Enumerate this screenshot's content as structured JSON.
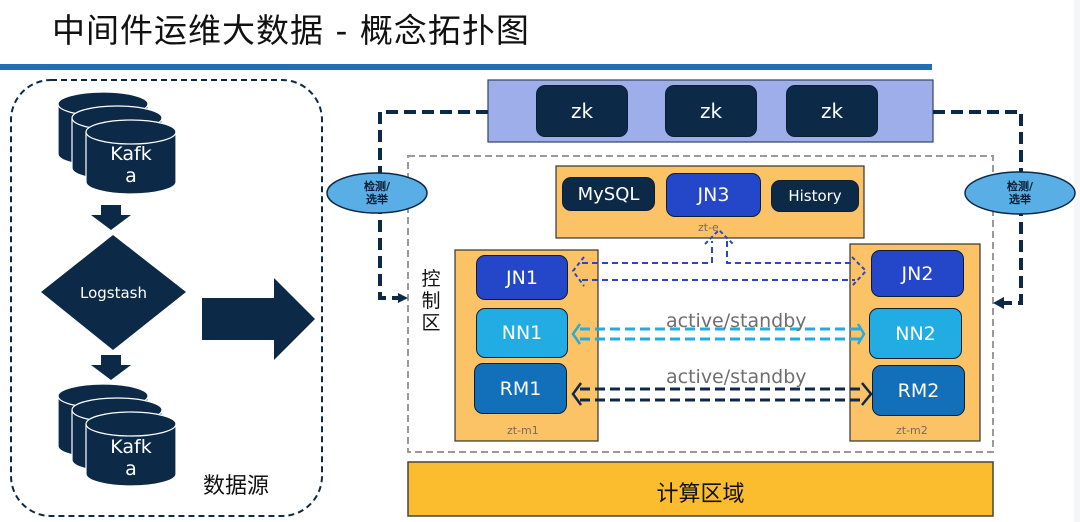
{
  "page": {
    "title": "中间件运维大数据 - 概念拓扑图",
    "accent_color": "#1f6fb6"
  },
  "data_source": {
    "label": "数据源",
    "top_store": {
      "label_line1": "Kafk",
      "label_line2": "a",
      "icon": "database-stack-icon"
    },
    "processor": {
      "label": "Logstash",
      "icon": "diamond-shape"
    },
    "bottom_store": {
      "label_line1": "Kafk",
      "label_line2": "a",
      "icon": "database-stack-icon"
    },
    "flow_arrow": "right-arrow-icon"
  },
  "zookeeper": {
    "nodes": [
      {
        "label": "zk"
      },
      {
        "label": "zk"
      },
      {
        "label": "zk"
      }
    ],
    "color": "#9eaeea"
  },
  "election": {
    "left_label_line1": "检测/",
    "left_label_line2": "选举",
    "right_label_line1": "检测/",
    "right_label_line2": "选举",
    "color": "#5aaee6"
  },
  "control_zone": {
    "label_chars": [
      "控",
      "制",
      "区"
    ],
    "hosts": {
      "zt_e": {
        "label": "zt-e",
        "nodes": [
          {
            "label": "MySQL",
            "kind": "dark"
          },
          {
            "label": "JN3",
            "kind": "jn"
          },
          {
            "label": "History",
            "kind": "dark"
          }
        ]
      },
      "zt_m1": {
        "label": "zt-m1",
        "nodes": [
          {
            "label": "JN1",
            "kind": "jn"
          },
          {
            "label": "NN1",
            "kind": "nn"
          },
          {
            "label": "RM1",
            "kind": "rm"
          }
        ]
      },
      "zt_m2": {
        "label": "zt-m2",
        "nodes": [
          {
            "label": "JN2",
            "kind": "jn"
          },
          {
            "label": "NN2",
            "kind": "nn"
          },
          {
            "label": "RM2",
            "kind": "rm"
          }
        ]
      }
    },
    "links": [
      {
        "from": "NN1",
        "to": "NN2",
        "label": "active/standby"
      },
      {
        "from": "RM1",
        "to": "RM2",
        "label": "active/standby"
      }
    ],
    "host_color": "#fbc365"
  },
  "compute_zone": {
    "label": "计算区域",
    "color": "#fbbd2e"
  }
}
